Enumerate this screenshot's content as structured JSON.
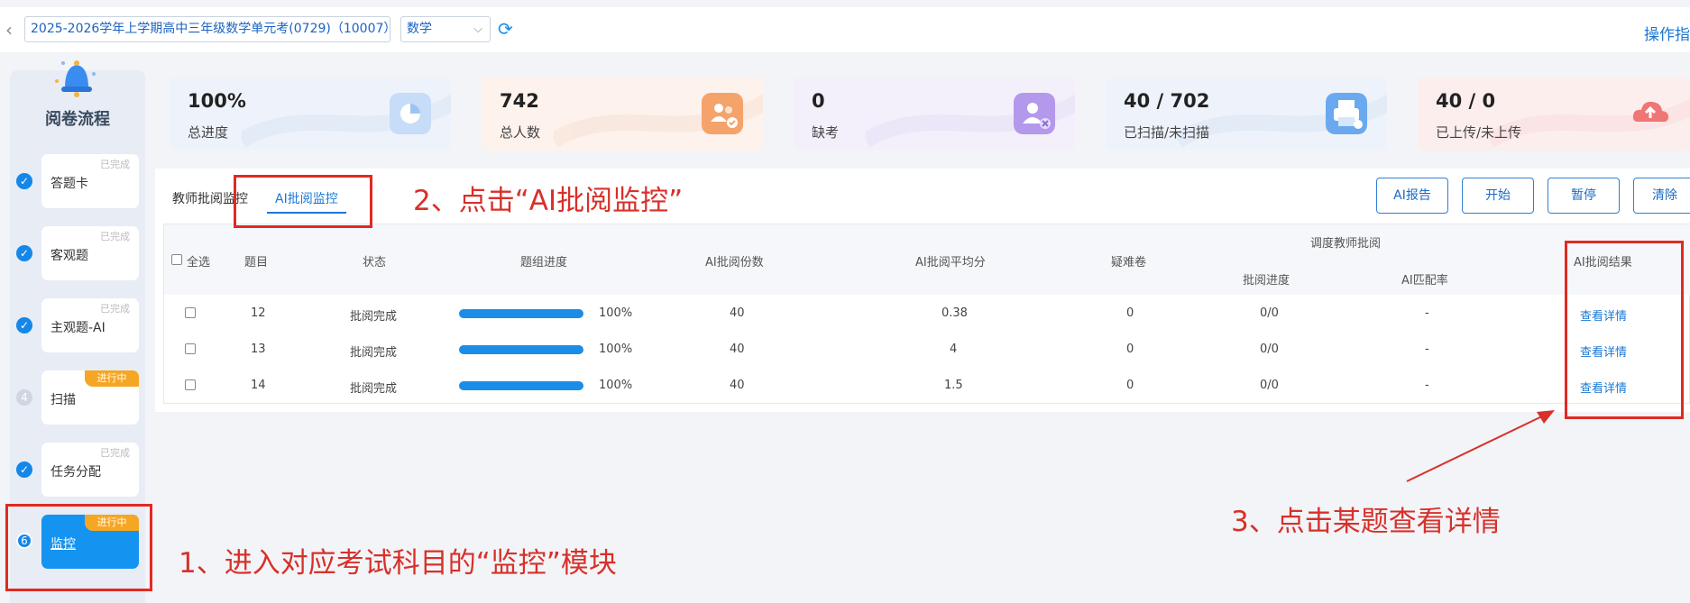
{
  "topbar": {
    "exam": "2025-2026学年上学期高中三年级数学单元考(0729)（10007）",
    "subject": "数学",
    "ops": "操作指"
  },
  "sidebar": {
    "title": "阅卷流程",
    "steps": [
      {
        "label": "答题卡",
        "status": "已完成"
      },
      {
        "label": "客观题",
        "status": "已完成"
      },
      {
        "label": "主观题-AI",
        "status": "已完成"
      },
      {
        "label": "扫描",
        "status": "进行中",
        "num": "4"
      },
      {
        "label": "任务分配",
        "status": "已完成"
      },
      {
        "label": "监控",
        "status": "进行中",
        "num": "6"
      }
    ]
  },
  "stats": [
    {
      "value": "100%",
      "label": "总进度",
      "color": "#eef3fb",
      "icon": "pie-chart-icon",
      "iconColor": "#9cc4f3"
    },
    {
      "value": "742",
      "label": "总人数",
      "color": "#fdf2ec",
      "icon": "users-icon",
      "iconColor": "#f4a36b"
    },
    {
      "value": "0",
      "label": "缺考",
      "color": "#f3f0fb",
      "icon": "user-absent-icon",
      "iconColor": "#b498ec"
    },
    {
      "value": "40 / 702",
      "label": "已扫描/未扫描",
      "color": "#eef3fb",
      "icon": "scanner-icon",
      "iconColor": "#6aa9ef"
    },
    {
      "value": "40 / 0",
      "label": "已上传/未上传",
      "color": "#fdeeee",
      "icon": "upload-icon",
      "iconColor": "#f07575"
    }
  ],
  "tabs": {
    "teacher": "教师批阅监控",
    "ai": "AI批阅监控"
  },
  "buttons": {
    "report": "AI报告",
    "start": "开始",
    "pause": "暂停",
    "clear": "清除"
  },
  "table": {
    "headers": {
      "selectAll": "全选",
      "question": "题目",
      "status": "状态",
      "progress": "题组进度",
      "aiCount": "AI批阅份数",
      "aiAvg": "AI批阅平均分",
      "hard": "疑难卷",
      "dispatch": "调度教师批阅",
      "dispatchProgress": "批阅进度",
      "matchRate": "AI匹配率",
      "result": "AI批阅结果"
    },
    "rows": [
      {
        "q": "12",
        "status": "批阅完成",
        "progress": 1.0,
        "progressText": "100%",
        "count": "40",
        "avg": "0.38",
        "hard": "0",
        "dp": "0/0",
        "rate": "-",
        "link": "查看详情"
      },
      {
        "q": "13",
        "status": "批阅完成",
        "progress": 1.0,
        "progressText": "100%",
        "count": "40",
        "avg": "4",
        "hard": "0",
        "dp": "0/0",
        "rate": "-",
        "link": "查看详情"
      },
      {
        "q": "14",
        "status": "批阅完成",
        "progress": 1.0,
        "progressText": "100%",
        "count": "40",
        "avg": "1.5",
        "hard": "0",
        "dp": "0/0",
        "rate": "-",
        "link": "查看详情"
      }
    ]
  },
  "annotations": {
    "step1": "1、进入对应考试科目的“监控”模块",
    "step2": "2、点击“AI批阅监控”",
    "step3": "3、点击某题查看详情"
  }
}
